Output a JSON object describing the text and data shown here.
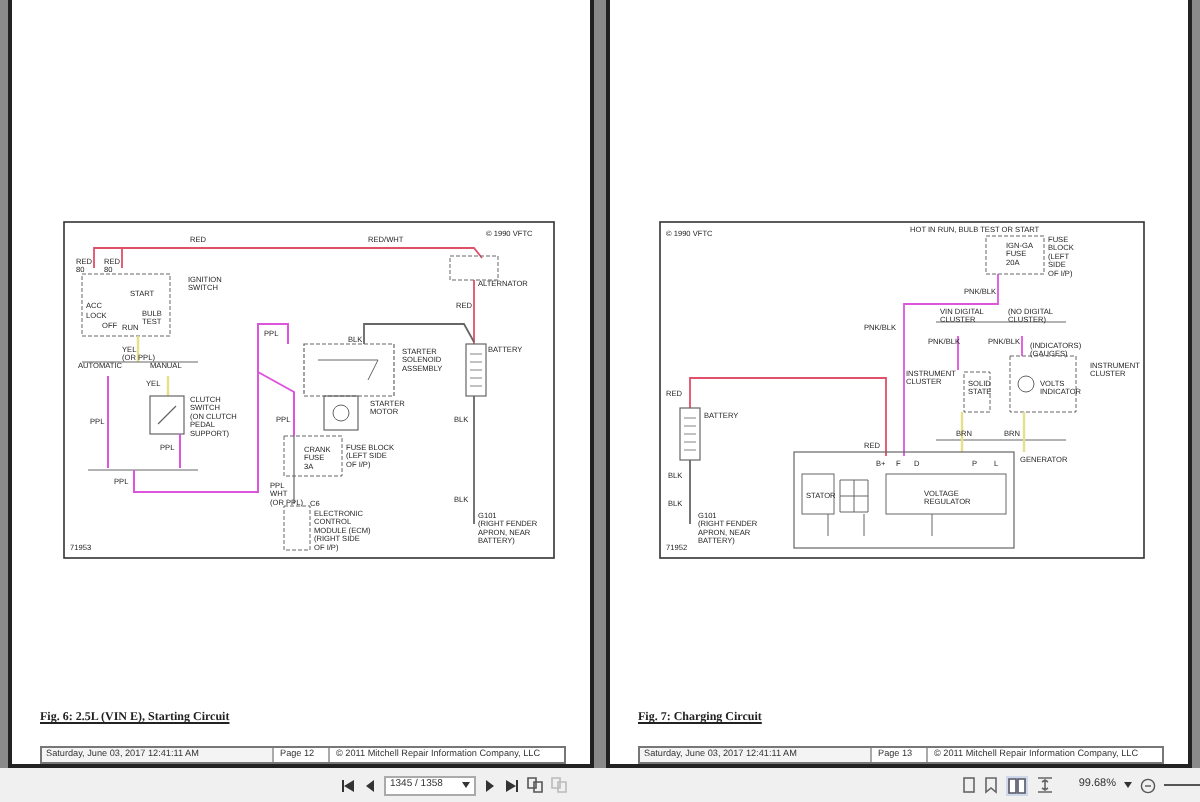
{
  "pages": [
    {
      "figure": {
        "kind": "starting",
        "copyright": "© 1990 VFTC",
        "number": "71953",
        "labels": [
          "RED",
          "RED/WHT",
          "RED\n80",
          "RED\n80",
          "IGNITION\nSWITCH",
          "ALTERNATOR",
          "START",
          "ACC",
          "LOCK",
          "OFF",
          "RUN",
          "BULB\nTEST",
          "RED",
          "YEL\n(OR PPL)",
          "PPL",
          "BLK",
          "AUTOMATIC",
          "MANUAL",
          "STARTER\nSOLENOID\nASSEMBLY",
          "BATTERY",
          "YEL",
          "PPL",
          "CLUTCH\nSWITCH\n(ON CLUTCH\nPEDAL\nSUPPORT)",
          "PPL",
          "STARTER\nMOTOR",
          "BLK",
          "PPL",
          "CRANK\nFUSE\n3A",
          "FUSE BLOCK\n(LEFT SIDE\nOF I/P)",
          "PPL",
          "PPL\nWHT\n(OR PPL)",
          "C6",
          "BLK",
          "ELECTRONIC\nCONTROL\nMODULE (ECM)\n(RIGHT SIDE\nOF I/P)",
          "G101\n(RIGHT FENDER\nAPRON, NEAR\nBATTERY)"
        ]
      },
      "caption": "Fig. 6: 2.5L (VIN E), Starting Circuit",
      "footer": {
        "date": "Saturday, June 03, 2017 12:41:11 AM",
        "page": "Page 12",
        "copyright": "© 2011 Mitchell Repair Information Company, LLC"
      }
    },
    {
      "figure": {
        "kind": "charging",
        "copyright": "© 1990 VFTC",
        "number": "71952",
        "labels": [
          "HOT IN RUN, BULB TEST OR START",
          "IGN-GA\nFUSE\n20A",
          "FUSE\nBLOCK\n(LEFT\nSIDE\nOF I/P)",
          "PNK/BLK",
          "PNK/BLK",
          "VIN DIGITAL\nCLUSTER",
          "(NO DIGITAL\nCLUSTER)",
          "PNK/BLK",
          "PNK/BLK",
          "(INDICATORS)\n(GAUGES)",
          "INSTRUMENT\nCLUSTER",
          "INSTRUMENT\nCLUSTER",
          "RED",
          "SOLID\nSTATE",
          "VOLTS\nINDICATOR",
          "BATTERY",
          "BRN",
          "BRN",
          "RED",
          "B+",
          "F",
          "D",
          "P",
          "L",
          "GENERATOR",
          "BLK",
          "BLK",
          "STATOR",
          "VOLTAGE\nREGULATOR",
          "G101\n(RIGHT FENDER\nAPRON, NEAR\nBATTERY)"
        ]
      },
      "caption": "Fig. 7: Charging Circuit",
      "footer": {
        "date": "Saturday, June 03, 2017 12:41:11 AM",
        "page": "Page 13",
        "copyright": "© 2011 Mitchell Repair Information Company, LLC"
      }
    }
  ],
  "toolbar": {
    "page_field": "1345 / 1358",
    "zoom": "99.68%"
  }
}
